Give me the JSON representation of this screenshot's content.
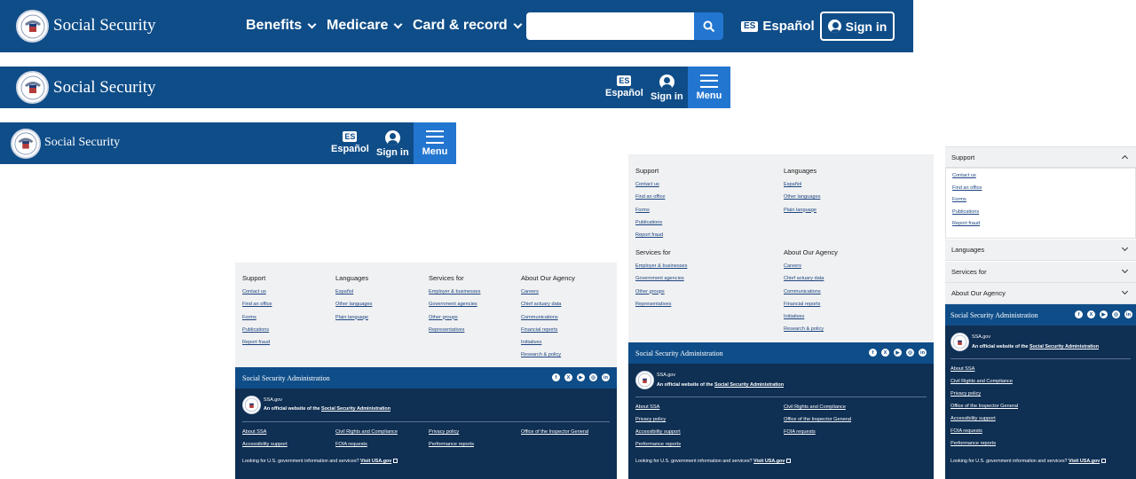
{
  "brand": {
    "name": "Social Security"
  },
  "header": {
    "nav": [
      {
        "label": "Benefits"
      },
      {
        "label": "Medicare"
      },
      {
        "label": "Card & record"
      }
    ],
    "search": {
      "placeholder": "",
      "value": ""
    },
    "espanol": "Español",
    "es_badge": "ES",
    "sign_in": "Sign in",
    "menu": "Menu"
  },
  "footer": {
    "support": {
      "heading": "Support",
      "links": [
        "Contact us",
        "Find an office",
        "Forms",
        "Publications",
        "Report fraud"
      ]
    },
    "languages": {
      "heading": "Languages",
      "links": [
        "Español",
        "Other languages",
        "Plain language"
      ]
    },
    "services": {
      "heading": "Services for",
      "links": [
        "Employer & businesses",
        "Government agencies",
        "Other groups",
        "Representatives"
      ]
    },
    "agency": {
      "heading": "About Our Agency",
      "links": [
        "Careers",
        "Chief actuary data",
        "Communications",
        "Financial reports",
        "Initiatives",
        "Research & policy"
      ]
    },
    "org_name": "Social Security Administration",
    "social": [
      "f",
      "X",
      "▶",
      "◎",
      "in"
    ],
    "site": "SSA.gov",
    "official_prefix": "An official website of the",
    "official_link": "Social Security Administration",
    "bottom_links": [
      "About SSA",
      "Civil Rights and Compliance",
      "Privacy policy",
      "Office of the Inspector General",
      "Accessibility support",
      "FOIA requests",
      "Performance reports"
    ],
    "looking": "Looking for U.S. government information and services?",
    "visit": "Visit USA.gov"
  },
  "colors": {
    "primary": "#0f4d88",
    "dark": "#0f2f53",
    "accent": "#2376d0",
    "light": "#f0f1f2"
  }
}
